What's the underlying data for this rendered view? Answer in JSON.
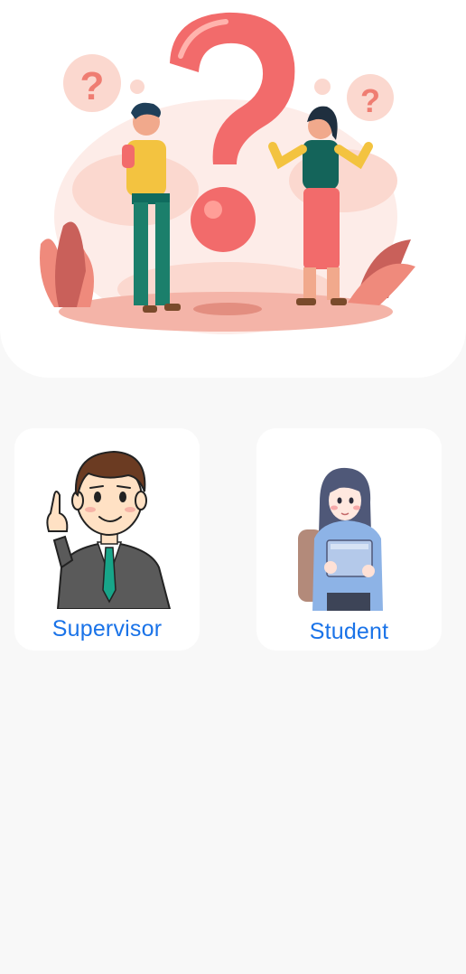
{
  "roles": {
    "supervisor": {
      "label": "Supervisor",
      "icon": "supervisor-avatar-icon"
    },
    "student": {
      "label": "Student",
      "icon": "student-avatar-icon"
    }
  },
  "hero": {
    "illustration": "question-mark-people-illustration"
  },
  "colors": {
    "background": "#f8f8f8",
    "card": "#ffffff",
    "label_blue": "#1a73e8",
    "accent_red": "#f26b6b"
  }
}
